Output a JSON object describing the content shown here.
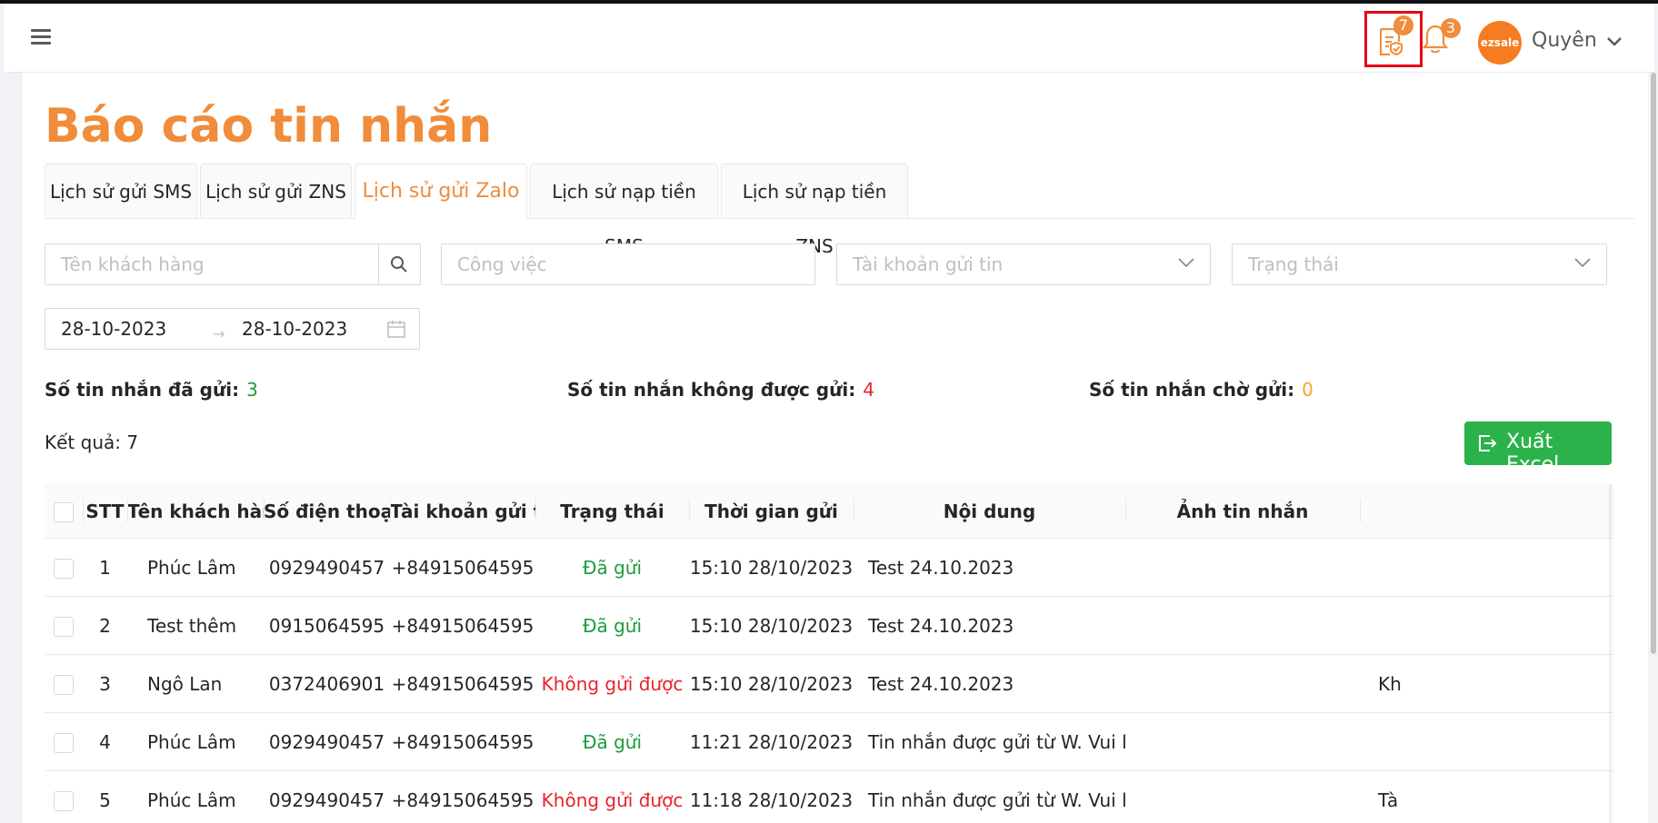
{
  "header": {
    "report_badge": "7",
    "bell_badge": "3",
    "avatar_text": "ezsale",
    "user_name": "Quyên"
  },
  "page": {
    "title": "Báo cáo tin nhắn"
  },
  "tabs": [
    {
      "label": "Lịch sử gửi SMS"
    },
    {
      "label": "Lịch sử gửi ZNS"
    },
    {
      "label": "Lịch sử gửi Zalo",
      "active": true
    },
    {
      "label": "Lịch sử nạp tiền SMS"
    },
    {
      "label": "Lịch sử nạp tiền ZNS"
    }
  ],
  "filters": {
    "customer_placeholder": "Tên khách hàng",
    "job_placeholder": "Công việc",
    "account_placeholder": "Tài khoản gửi tin",
    "status_placeholder": "Trạng thái",
    "date_from": "28-10-2023",
    "date_to": "28-10-2023"
  },
  "stats": {
    "sent_label": "Số tin nhắn đã gửi:",
    "sent_value": "3",
    "failed_label": "Số tin nhắn không được gửi:",
    "failed_value": "4",
    "pending_label": "Số tin nhắn chờ gửi:",
    "pending_value": "0"
  },
  "result_text": "Kết quả: 7",
  "export_label": "Xuất Excel",
  "table": {
    "columns": [
      "STT",
      "Tên khách hàng",
      "Số điện thoại",
      "Tài khoản gửi tin",
      "Trạng thái",
      "Thời gian gửi",
      "Nội dung",
      "Ảnh tin nhắn",
      ""
    ],
    "rows": [
      {
        "stt": "1",
        "name": "Phúc Lâm",
        "phone": "0929490457",
        "account": "+84915064595",
        "status": "Đã gửi",
        "status_type": "ok",
        "time": "15:10 28/10/2023",
        "content": "Test 24.10.2023",
        "image": "",
        "extra": ""
      },
      {
        "stt": "2",
        "name": "Test thêm",
        "phone": "0915064595",
        "account": "+84915064595",
        "status": "Đã gửi",
        "status_type": "ok",
        "time": "15:10 28/10/2023",
        "content": "Test 24.10.2023",
        "image": "",
        "extra": ""
      },
      {
        "stt": "3",
        "name": "Ngô Lan",
        "phone": "0372406901",
        "account": "+84915064595",
        "status": "Không gửi được",
        "status_type": "fail",
        "time": "15:10 28/10/2023",
        "content": "Test 24.10.2023",
        "image": "",
        "extra": "Kh"
      },
      {
        "stt": "4",
        "name": "Phúc Lâm",
        "phone": "0929490457",
        "account": "+84915064595",
        "status": "Đã gửi",
        "status_type": "ok",
        "time": "11:21 28/10/2023",
        "content": "Tin nhắn được gửi từ W. Vui lò...",
        "image": "",
        "extra": ""
      },
      {
        "stt": "5",
        "name": "Phúc Lâm",
        "phone": "0929490457",
        "account": "+84915064595",
        "status": "Không gửi được",
        "status_type": "fail",
        "time": "11:18 28/10/2023",
        "content": "Tin nhắn được gửi từ W. Vui lò...",
        "image": "",
        "extra": "Tà"
      }
    ]
  },
  "colors": {
    "accent": "#f08c3a",
    "success": "#1e9c3c",
    "danger": "#e8232b",
    "warning": "#f5a623",
    "export_button": "#2cb24a"
  }
}
